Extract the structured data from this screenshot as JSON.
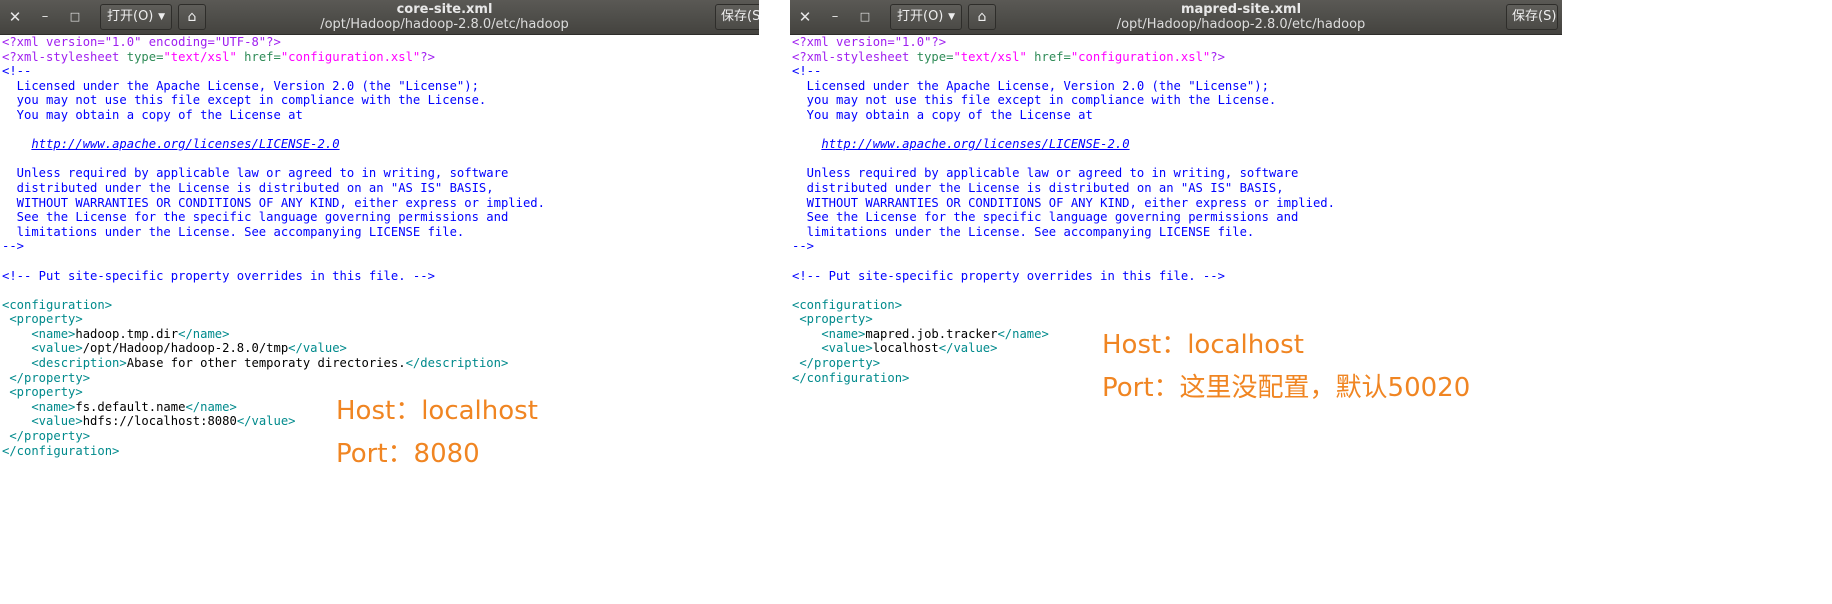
{
  "windows": [
    {
      "title": "core-site.xml",
      "path": "/opt/Hadoop/hadoop-2.8.0/etc/hadoop",
      "open_label": "打开(O)",
      "save_label": "保存(S",
      "lines": [
        [
          [
            "c-pi",
            "<?xml version=\"1.0\" encoding=\"UTF-8\"?>"
          ]
        ],
        [
          [
            "c-pi",
            "<?xml-stylesheet "
          ],
          [
            "c-attr",
            "type="
          ],
          [
            "c-str",
            "\"text/xsl\""
          ],
          [
            "c-attr",
            " href="
          ],
          [
            "c-str",
            "\"configuration.xsl\""
          ],
          [
            "c-pi",
            "?>"
          ]
        ],
        [
          [
            "c-cm",
            "<!--"
          ]
        ],
        [
          [
            "c-cm",
            "  Licensed under the Apache License, Version 2.0 (the \"License\");"
          ]
        ],
        [
          [
            "c-cm",
            "  you may not use this file except in compliance with the License."
          ]
        ],
        [
          [
            "c-cm",
            "  You may obtain a copy of the License at"
          ]
        ],
        [
          [
            "c-cm",
            ""
          ]
        ],
        [
          [
            "c-cm",
            "    "
          ],
          [
            "c-link",
            "http://www.apache.org/licenses/LICENSE-2.0"
          ]
        ],
        [
          [
            "c-cm",
            ""
          ]
        ],
        [
          [
            "c-cm",
            "  Unless required by applicable law or agreed to in writing, software"
          ]
        ],
        [
          [
            "c-cm",
            "  distributed under the License is distributed on an \"AS IS\" BASIS,"
          ]
        ],
        [
          [
            "c-cm",
            "  WITHOUT WARRANTIES OR CONDITIONS OF ANY KIND, either express or implied."
          ]
        ],
        [
          [
            "c-cm",
            "  See the License for the specific language governing permissions and"
          ]
        ],
        [
          [
            "c-cm",
            "  limitations under the License. See accompanying LICENSE file."
          ]
        ],
        [
          [
            "c-cm",
            "-->"
          ]
        ],
        [
          [
            "c-text",
            ""
          ]
        ],
        [
          [
            "c-cm",
            "<!-- Put site-specific property overrides in this file. -->"
          ]
        ],
        [
          [
            "c-text",
            ""
          ]
        ],
        [
          [
            "c-tag",
            "<configuration>"
          ]
        ],
        [
          [
            "c-tag",
            " <property>"
          ]
        ],
        [
          [
            "c-tag",
            "    <name>"
          ],
          [
            "c-text",
            "hadoop.tmp.dir"
          ],
          [
            "c-tag",
            "</name>"
          ]
        ],
        [
          [
            "c-tag",
            "    <value>"
          ],
          [
            "c-text",
            "/opt/Hadoop/hadoop-2.8.0/tmp"
          ],
          [
            "c-tag",
            "</value>"
          ]
        ],
        [
          [
            "c-tag",
            "    <description>"
          ],
          [
            "c-text",
            "Abase for other temporaty directories."
          ],
          [
            "c-tag",
            "</description>"
          ]
        ],
        [
          [
            "c-tag",
            " </property>"
          ]
        ],
        [
          [
            "c-tag",
            " <property>"
          ]
        ],
        [
          [
            "c-tag",
            "    <name>"
          ],
          [
            "c-text",
            "fs.default.name"
          ],
          [
            "c-tag",
            "</name>"
          ]
        ],
        [
          [
            "c-tag",
            "    <value>"
          ],
          [
            "c-text",
            "hdfs://localhost:8080"
          ],
          [
            "c-tag",
            "</value>"
          ]
        ],
        [
          [
            "c-tag",
            " </property>"
          ]
        ],
        [
          [
            "c-tag",
            "</configuration>"
          ]
        ]
      ],
      "notes": [
        "Host：localhost",
        "Port：8080"
      ]
    },
    {
      "title": "mapred-site.xml",
      "path": "/opt/Hadoop/hadoop-2.8.0/etc/hadoop",
      "open_label": "打开(O)",
      "save_label": "保存(S)",
      "lines": [
        [
          [
            "c-pi",
            "<?xml version=\"1.0\"?>"
          ]
        ],
        [
          [
            "c-pi",
            "<?xml-stylesheet "
          ],
          [
            "c-attr",
            "type="
          ],
          [
            "c-str",
            "\"text/xsl\""
          ],
          [
            "c-attr",
            " href="
          ],
          [
            "c-str",
            "\"configuration.xsl\""
          ],
          [
            "c-pi",
            "?>"
          ]
        ],
        [
          [
            "c-cm",
            "<!--"
          ]
        ],
        [
          [
            "c-cm",
            "  Licensed under the Apache License, Version 2.0 (the \"License\");"
          ]
        ],
        [
          [
            "c-cm",
            "  you may not use this file except in compliance with the License."
          ]
        ],
        [
          [
            "c-cm",
            "  You may obtain a copy of the License at"
          ]
        ],
        [
          [
            "c-cm",
            ""
          ]
        ],
        [
          [
            "c-cm",
            "    "
          ],
          [
            "c-link",
            "http://www.apache.org/licenses/LICENSE-2.0"
          ]
        ],
        [
          [
            "c-cm",
            ""
          ]
        ],
        [
          [
            "c-cm",
            "  Unless required by applicable law or agreed to in writing, software"
          ]
        ],
        [
          [
            "c-cm",
            "  distributed under the License is distributed on an \"AS IS\" BASIS,"
          ]
        ],
        [
          [
            "c-cm",
            "  WITHOUT WARRANTIES OR CONDITIONS OF ANY KIND, either express or implied."
          ]
        ],
        [
          [
            "c-cm",
            "  See the License for the specific language governing permissions and"
          ]
        ],
        [
          [
            "c-cm",
            "  limitations under the License. See accompanying LICENSE file."
          ]
        ],
        [
          [
            "c-cm",
            "-->"
          ]
        ],
        [
          [
            "c-text",
            ""
          ]
        ],
        [
          [
            "c-cm",
            "<!-- Put site-specific property overrides in this file. -->"
          ]
        ],
        [
          [
            "c-text",
            ""
          ]
        ],
        [
          [
            "c-tag",
            "<configuration>"
          ]
        ],
        [
          [
            "c-tag",
            " <property>"
          ]
        ],
        [
          [
            "c-tag",
            "    <name>"
          ],
          [
            "c-text",
            "mapred.job.tracker"
          ],
          [
            "c-tag",
            "</name>"
          ]
        ],
        [
          [
            "c-tag",
            "    <value>"
          ],
          [
            "c-text",
            "localhost"
          ],
          [
            "c-tag",
            "</value>"
          ]
        ],
        [
          [
            "c-tag",
            " </property>"
          ]
        ],
        [
          [
            "c-tag",
            "</configuration>"
          ]
        ]
      ],
      "notes": [
        "Host：localhost",
        "Port：这里没配置，默认50020"
      ]
    }
  ],
  "icons": {
    "close": "✕",
    "minimize": "–",
    "maximize": "□",
    "dropdown": "▼",
    "pin": "⌂"
  }
}
